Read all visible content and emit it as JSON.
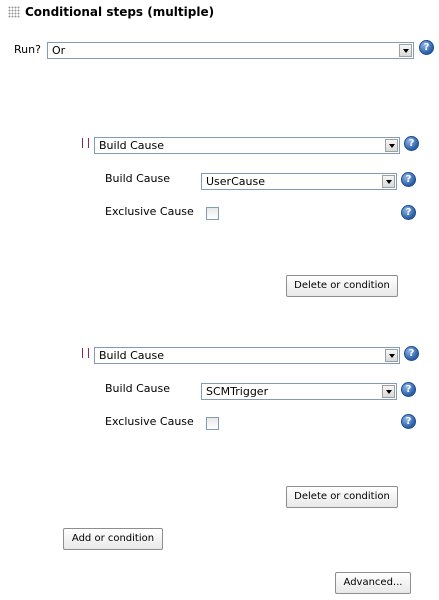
{
  "section": {
    "title": "Conditional steps (multiple)"
  },
  "run": {
    "label": "Run?",
    "value": "Or"
  },
  "conditions": [
    {
      "type_value": "Build Cause",
      "build_cause_label": "Build Cause",
      "build_cause_value": "UserCause",
      "exclusive_label": "Exclusive Cause",
      "delete_label": "Delete or condition"
    },
    {
      "type_value": "Build Cause",
      "build_cause_label": "Build Cause",
      "build_cause_value": "SCMTrigger",
      "exclusive_label": "Exclusive Cause",
      "delete_label": "Delete or condition"
    }
  ],
  "buttons": {
    "add_condition": "Add or condition",
    "advanced": "Advanced..."
  },
  "help_glyph": "?"
}
